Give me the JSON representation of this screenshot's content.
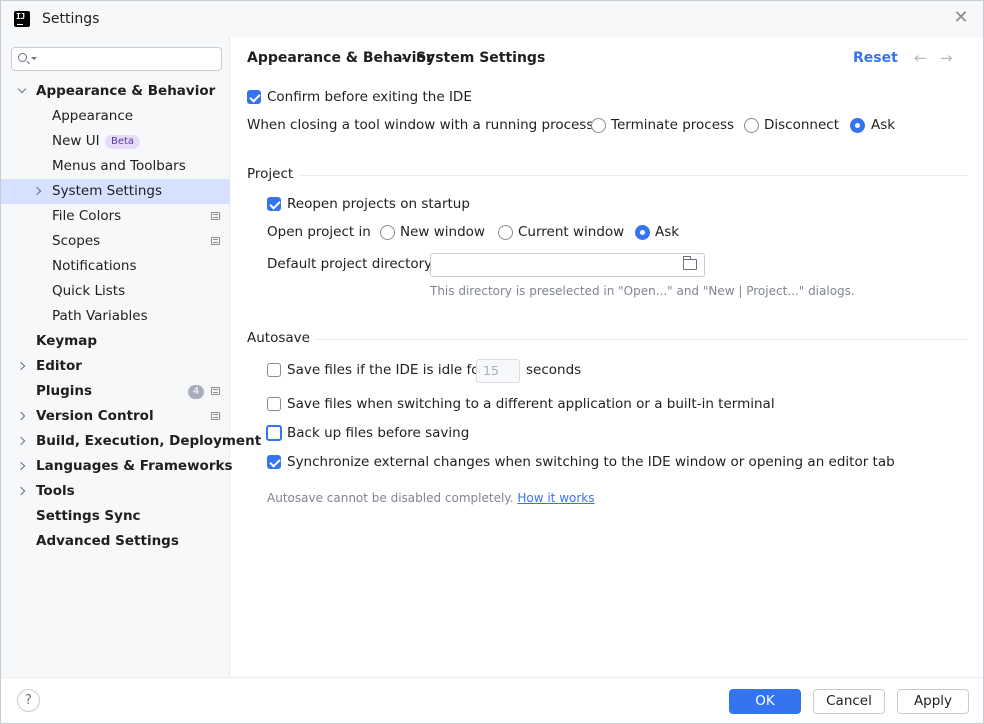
{
  "window": {
    "title": "Settings",
    "app_icon_text": "IJ"
  },
  "search": {
    "placeholder": "",
    "value": ""
  },
  "sidebar": {
    "items": [
      {
        "label": "Appearance & Behavior"
      },
      {
        "label": "Appearance"
      },
      {
        "label": "New UI",
        "badge": "Beta"
      },
      {
        "label": "Menus and Toolbars"
      },
      {
        "label": "System Settings"
      },
      {
        "label": "File Colors"
      },
      {
        "label": "Scopes"
      },
      {
        "label": "Notifications"
      },
      {
        "label": "Quick Lists"
      },
      {
        "label": "Path Variables"
      },
      {
        "label": "Keymap"
      },
      {
        "label": "Editor"
      },
      {
        "label": "Plugins",
        "count": "4"
      },
      {
        "label": "Version Control"
      },
      {
        "label": "Build, Execution, Deployment"
      },
      {
        "label": "Languages & Frameworks"
      },
      {
        "label": "Tools"
      },
      {
        "label": "Settings Sync"
      },
      {
        "label": "Advanced Settings"
      }
    ]
  },
  "header": {
    "breadcrumb_parent": "Appearance & Behavior",
    "breadcrumb_sep": "›",
    "breadcrumb_current": "System Settings",
    "reset": "Reset",
    "back_arrow": "←",
    "forward_arrow": "→"
  },
  "general": {
    "confirm_exit": {
      "label": "Confirm before exiting the IDE",
      "checked": true
    },
    "closing_label": "When closing a tool window with a running process:",
    "closing_options": [
      "Terminate process",
      "Disconnect",
      "Ask"
    ],
    "closing_selected": "Ask"
  },
  "project": {
    "title": "Project",
    "reopen": {
      "label": "Reopen projects on startup",
      "checked": true
    },
    "open_in_label": "Open project in",
    "open_in_options": [
      "New window",
      "Current window",
      "Ask"
    ],
    "open_in_selected": "Ask",
    "default_dir_label": "Default project directory:",
    "default_dir_value": "",
    "default_dir_hint": "This directory is preselected in \"Open...\" and \"New | Project...\" dialogs."
  },
  "autosave": {
    "title": "Autosave",
    "idle": {
      "label": "Save files if the IDE is idle for",
      "value": "15",
      "suffix": "seconds",
      "checked": false
    },
    "switching": {
      "label": "Save files when switching to a different application or a built-in terminal",
      "checked": false
    },
    "backup": {
      "label": "Back up files before saving",
      "checked": false
    },
    "sync": {
      "label": "Synchronize external changes when switching to the IDE window or opening an editor tab",
      "checked": true
    },
    "note": "Autosave cannot be disabled completely.",
    "note_link": "How it works"
  },
  "footer": {
    "help": "?",
    "ok": "OK",
    "cancel": "Cancel",
    "apply": "Apply"
  },
  "colors": {
    "accent": "#3574f0",
    "selection": "#d5e1ff",
    "sidebar_bg": "#f7f8fa"
  }
}
